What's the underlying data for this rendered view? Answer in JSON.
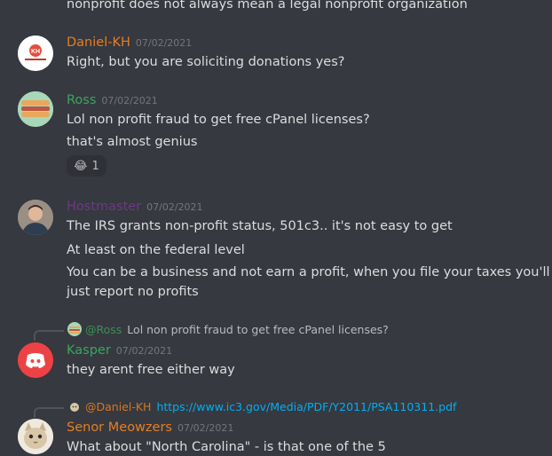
{
  "colors": {
    "background": "#36393f",
    "text": "#dcddde",
    "timestamp": "#72767d",
    "daniel": "#e67e22",
    "ross": "#3ba55d",
    "hostmaster": "#71368a",
    "kasper": "#3ba55d",
    "senor": "#e67e22",
    "link": "#00aff4"
  },
  "top_line": "nonprofit does not always mean a legal nonprofit organization",
  "messages": [
    {
      "author": "Daniel-KH",
      "timestamp": "07/02/2021",
      "avatar_icon": "kh-logo-icon",
      "lines": [
        "Right, but you are soliciting donations yes?"
      ]
    },
    {
      "author": "Ross",
      "timestamp": "07/02/2021",
      "avatar_icon": "food-avatar-icon",
      "lines": [
        "Lol non profit fraud to get free cPanel licenses?",
        "that's almost genius"
      ],
      "reaction": {
        "emoji": "😂",
        "count": "1"
      }
    },
    {
      "author": "Hostmaster",
      "timestamp": "07/02/2021",
      "avatar_icon": "person-avatar-icon",
      "lines": [
        "The IRS grants non-profit status, 501c3.. it's not easy to get",
        "At least on the federal level",
        "You can be a business and not earn a profit, when you file your taxes you'll",
        "just report no profits"
      ]
    },
    {
      "author": "Kasper",
      "timestamp": "07/02/2021",
      "avatar_icon": "discord-logo-icon",
      "reply": {
        "mention": "@Ross",
        "text": "Lol non profit fraud to get free cPanel licenses?"
      },
      "lines": [
        "they arent free either way"
      ]
    },
    {
      "author": "Senor Meowzers",
      "timestamp": "07/02/2021",
      "avatar_icon": "cat-avatar-icon",
      "reply": {
        "mention": "@Daniel-KH",
        "text": "https://www.ic3.gov/Media/PDF/Y2011/PSA110311.pdf"
      },
      "lines": [
        "What about \"North Carolina\" - is that one of the 5"
      ]
    }
  ]
}
